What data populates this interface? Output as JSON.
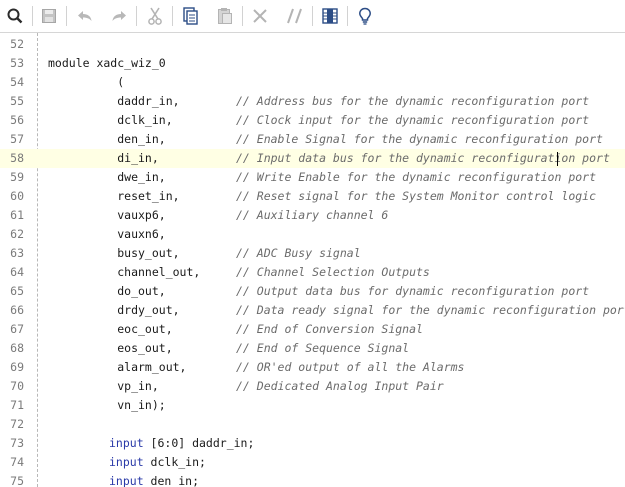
{
  "toolbar": {
    "icons": [
      "search-icon",
      "save-icon",
      "undo-icon",
      "redo-icon",
      "cut-icon",
      "copy-icon",
      "paste-icon",
      "delete-icon",
      "comment-icon",
      "column-select-icon",
      "hint-icon"
    ]
  },
  "editor": {
    "lines": [
      {
        "num": "52",
        "code": "",
        "comment": ""
      },
      {
        "num": "53",
        "code": "module xadc_wiz_0",
        "comment": ""
      },
      {
        "num": "54",
        "code": "          (",
        "comment": ""
      },
      {
        "num": "55",
        "code": "          daddr_in,",
        "comment": "// Address bus for the dynamic reconfiguration port"
      },
      {
        "num": "56",
        "code": "          dclk_in,",
        "comment": "// Clock input for the dynamic reconfiguration port"
      },
      {
        "num": "57",
        "code": "          den_in,",
        "comment": "// Enable Signal for the dynamic reconfiguration port"
      },
      {
        "num": "58",
        "code": "          di_in,",
        "comment": "// Input data bus for the dynamic reconfiguration port"
      },
      {
        "num": "59",
        "code": "          dwe_in,",
        "comment": "// Write Enable for the dynamic reconfiguration port"
      },
      {
        "num": "60",
        "code": "          reset_in,",
        "comment": "// Reset signal for the System Monitor control logic"
      },
      {
        "num": "61",
        "code": "          vauxp6,",
        "comment": "// Auxiliary channel 6"
      },
      {
        "num": "62",
        "code": "          vauxn6,",
        "comment": ""
      },
      {
        "num": "63",
        "code": "          busy_out,",
        "comment": "// ADC Busy signal"
      },
      {
        "num": "64",
        "code": "          channel_out,",
        "comment": "// Channel Selection Outputs"
      },
      {
        "num": "65",
        "code": "          do_out,",
        "comment": "// Output data bus for dynamic reconfiguration port"
      },
      {
        "num": "66",
        "code": "          drdy_out,",
        "comment": "// Data ready signal for the dynamic reconfiguration port"
      },
      {
        "num": "67",
        "code": "          eoc_out,",
        "comment": "// End of Conversion Signal"
      },
      {
        "num": "68",
        "code": "          eos_out,",
        "comment": "// End of Sequence Signal"
      },
      {
        "num": "69",
        "code": "          alarm_out,",
        "comment": "// OR'ed output of all the Alarms"
      },
      {
        "num": "70",
        "code": "          vp_in,",
        "comment": "// Dedicated Analog Input Pair"
      },
      {
        "num": "71",
        "code": "          vn_in);",
        "comment": ""
      },
      {
        "num": "72",
        "code": "",
        "comment": ""
      },
      {
        "num": "73",
        "kw": "input",
        "code": " [6:0] daddr_in;",
        "comment": ""
      },
      {
        "num": "74",
        "kw": "input",
        "code": " dclk_in;",
        "comment": ""
      },
      {
        "num": "75",
        "kw": "input",
        "code": " den_in;",
        "comment": ""
      }
    ],
    "current_line": "58",
    "colors": {
      "current_line_bg": "#ffffe4",
      "keyword": "#2a3aa8",
      "comment": "#6b6b6b"
    }
  }
}
